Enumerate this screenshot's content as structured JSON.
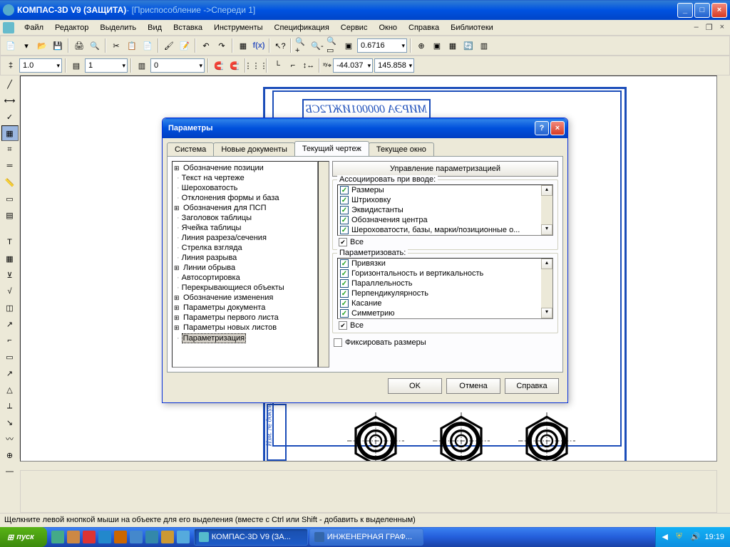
{
  "titlebar": {
    "app": "КОМПАС-3D V9 (ЗАЩИТА)",
    "doc": " - [Приспособление ->Спереди 1]"
  },
  "menu": [
    "Файл",
    "Редактор",
    "Выделить",
    "Вид",
    "Вставка",
    "Инструменты",
    "Спецификация",
    "Сервис",
    "Окно",
    "Справка",
    "Библиотеки"
  ],
  "toolbar1": {
    "zoom": "0.6716"
  },
  "toolbar2": {
    "width": "1.0",
    "layer": "1",
    "style": "0",
    "coord_x": "-44.037",
    "coord_y": "145.858"
  },
  "drawing": {
    "label": "МИРЭА 000001ИЖГ2СБ",
    "side": "Изм. № докум."
  },
  "dialog": {
    "title": "Параметры",
    "tabs": [
      "Система",
      "Новые документы",
      "Текущий чертеж",
      "Текущее окно"
    ],
    "active_tab": 2,
    "tree": [
      {
        "t": "Обозначение позиции",
        "k": "exp"
      },
      {
        "t": "Текст на чертеже",
        "k": "leaf"
      },
      {
        "t": "Шероховатость",
        "k": "leaf"
      },
      {
        "t": "Отклонения формы и база",
        "k": "leaf"
      },
      {
        "t": "Обозначения для ПСП",
        "k": "exp"
      },
      {
        "t": "Заголовок таблицы",
        "k": "leaf"
      },
      {
        "t": "Ячейка таблицы",
        "k": "leaf"
      },
      {
        "t": "Линия разреза/сечения",
        "k": "leaf"
      },
      {
        "t": "Стрелка взгляда",
        "k": "leaf"
      },
      {
        "t": "Линия разрыва",
        "k": "leaf"
      },
      {
        "t": "Линии обрыва",
        "k": "exp"
      },
      {
        "t": "Автосортировка",
        "k": "leaf"
      },
      {
        "t": "Перекрывающиеся объекты",
        "k": "leaf"
      },
      {
        "t": "Обозначение изменения",
        "k": "exp"
      },
      {
        "t": "Параметры документа",
        "k": "exp"
      },
      {
        "t": "Параметры первого листа",
        "k": "exp"
      },
      {
        "t": "Параметры новых листов",
        "k": "exp"
      },
      {
        "t": "Параметризация",
        "k": "leaf",
        "sel": true
      }
    ],
    "heading_btn": "Управление параметризацией",
    "group1": {
      "legend": "Ассоциировать при вводе:",
      "items": [
        "Размеры",
        "Штриховку",
        "Эквидистанты",
        "Обозначения центра",
        "Шероховатости, базы, марки/позиционные о..."
      ],
      "all": "Все"
    },
    "group2": {
      "legend": "Параметризовать:",
      "items": [
        "Привязки",
        "Горизонтальность и вертикальность",
        "Параллельность",
        "Перпендикулярность",
        "Касание",
        "Симметрию"
      ],
      "all": "Все"
    },
    "fixate": "Фиксировать размеры",
    "buttons": {
      "ok": "OK",
      "cancel": "Отмена",
      "help": "Справка"
    }
  },
  "statusbar": "Щелкните левой кнопкой мыши на объекте для его выделения (вместе с Ctrl или Shift - добавить к выделенным)",
  "taskbar": {
    "start": "пуск",
    "tasks": [
      {
        "label": "КОМПАС-3D V9 (ЗА...",
        "active": true
      },
      {
        "label": "ИНЖЕНЕРНАЯ ГРАФ...",
        "active": false
      }
    ],
    "clock": "19:19"
  }
}
